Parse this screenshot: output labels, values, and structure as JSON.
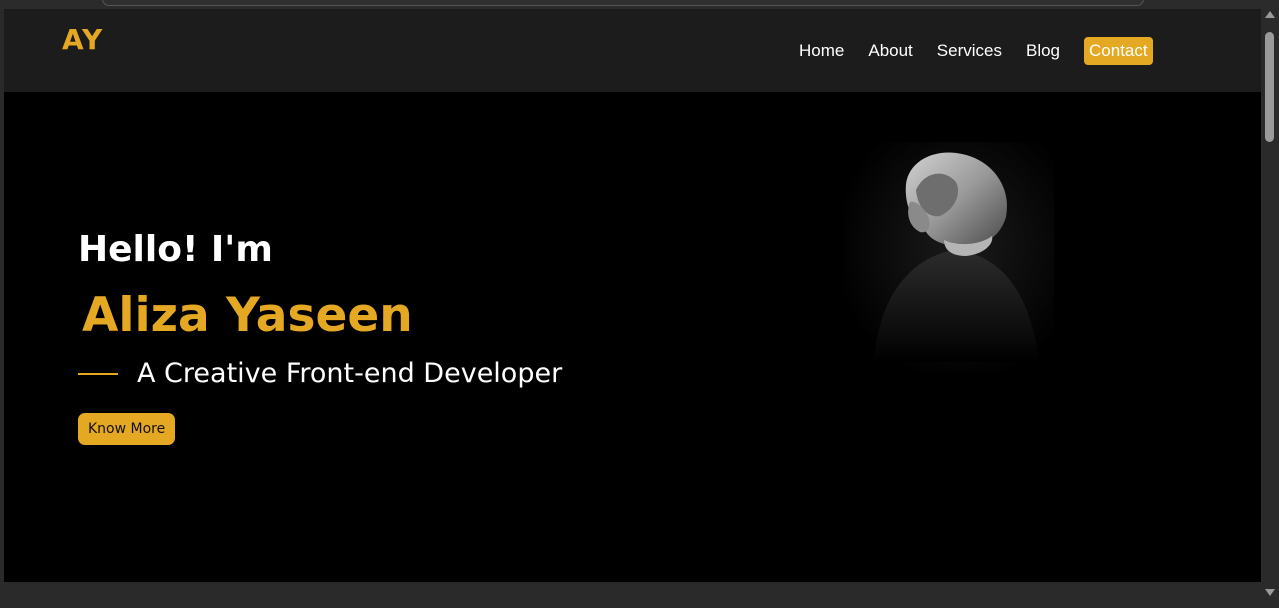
{
  "header": {
    "logo": "AY",
    "nav": [
      {
        "label": "Home"
      },
      {
        "label": "About"
      },
      {
        "label": "Services"
      },
      {
        "label": "Blog"
      }
    ],
    "contact_label": "Contact"
  },
  "hero": {
    "greeting": "Hello! I'm",
    "name": "Aliza Yaseen",
    "tagline": "A Creative Front-end Developer",
    "cta_label": "Know More",
    "image": "hooded-figure-portrait"
  },
  "colors": {
    "accent": "#e5a823",
    "navbar_bg": "#1c1c1c",
    "hero_bg": "#000000",
    "text": "#ffffff"
  },
  "icons": {
    "scroll_up": "triangle-up",
    "scroll_down": "triangle-down"
  }
}
